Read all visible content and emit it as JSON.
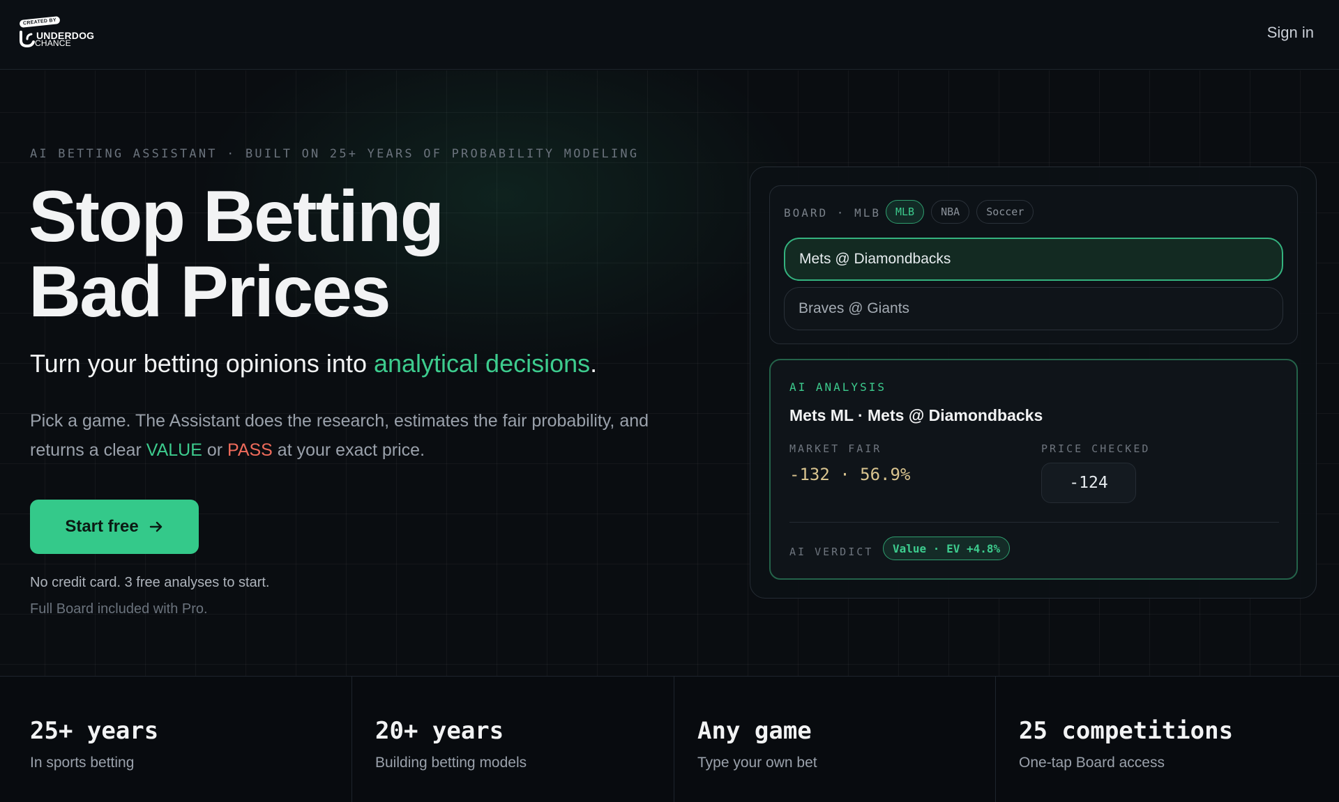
{
  "header": {
    "logo": {
      "badge": "CREATED BY",
      "line1": "UNDERDOG",
      "line2": "CHANCE"
    },
    "sign_in": "Sign in"
  },
  "hero": {
    "eyebrow": "AI BETTING ASSISTANT · BUILT ON 25+ YEARS OF PROBABILITY MODELING",
    "headline_line1": "Stop Betting",
    "headline_line2": "Bad Prices",
    "subhead_prefix": "Turn your betting opinions into ",
    "subhead_accent": "analytical decisions",
    "subhead_suffix": ".",
    "body_part1": "Pick a game. The Assistant does the research, estimates the fair probability, and returns a clear ",
    "body_value": "VALUE",
    "body_or": " or ",
    "body_pass": "PASS",
    "body_part2": " at your exact price.",
    "cta_label": "Start free",
    "note1": "No credit card. 3 free analyses to start.",
    "note2": "Full Board included with Pro."
  },
  "demo": {
    "board": {
      "label": "BOARD · MLB",
      "chips": [
        "MLB",
        "NBA",
        "Soccer"
      ],
      "active_chip": "MLB",
      "games": [
        "Mets @ Diamondbacks",
        "Braves @ Giants"
      ],
      "selected_game": "Mets @ Diamondbacks"
    },
    "analysis": {
      "label": "AI ANALYSIS",
      "title": "Mets ML · Mets @ Diamondbacks",
      "market_fair_label": "MARKET FAIR",
      "market_fair_value": "-132 · 56.9%",
      "price_checked_label": "PRICE CHECKED",
      "price_checked_value": "-124",
      "verdict_label": "AI VERDICT",
      "verdict_badge": "Value · EV +4.8%"
    }
  },
  "stats": [
    {
      "big": "25+ years",
      "small": "In sports betting"
    },
    {
      "big": "20+ years",
      "small": "Building betting models"
    },
    {
      "big": "Any game",
      "small": "Type your own bet"
    },
    {
      "big": "25 competitions",
      "small": "One-tap Board access"
    }
  ],
  "colors": {
    "accent_green": "#34c98a",
    "pass_red": "#ef6b5b",
    "background": "#0a0d11",
    "fair_value_gold": "#d9c48f"
  }
}
